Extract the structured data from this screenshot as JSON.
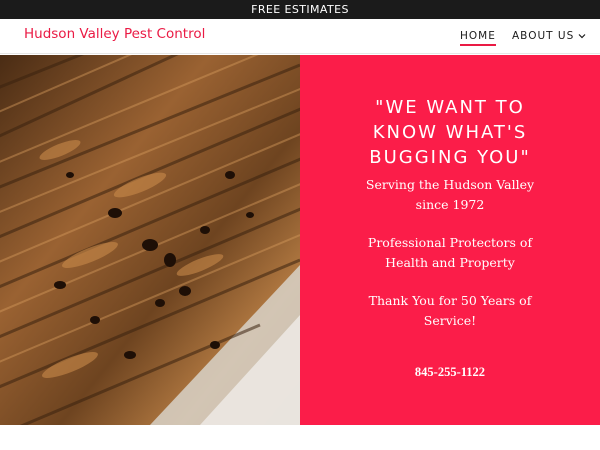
{
  "announcement": {
    "text": "FREE ESTIMATES"
  },
  "header": {
    "brand": "Hudson Valley Pest Control",
    "nav": {
      "home": "HOME",
      "about": "ABOUT US"
    }
  },
  "hero": {
    "headline": "\"WE WANT TO KNOW WHAT'S BUGGING YOU\"",
    "line1": "Serving the Hudson Valley since 1972",
    "line2": "Professional Protectors of Health and Property",
    "line3": "Thank You for 50 Years of Service!",
    "phone": "845-255-1122"
  },
  "colors": {
    "accent": "#fb1d49",
    "brand": "#ea1a44",
    "topbar": "#1b1b1b"
  },
  "icons": {
    "nav_dropdown": "chevron-down-icon"
  }
}
